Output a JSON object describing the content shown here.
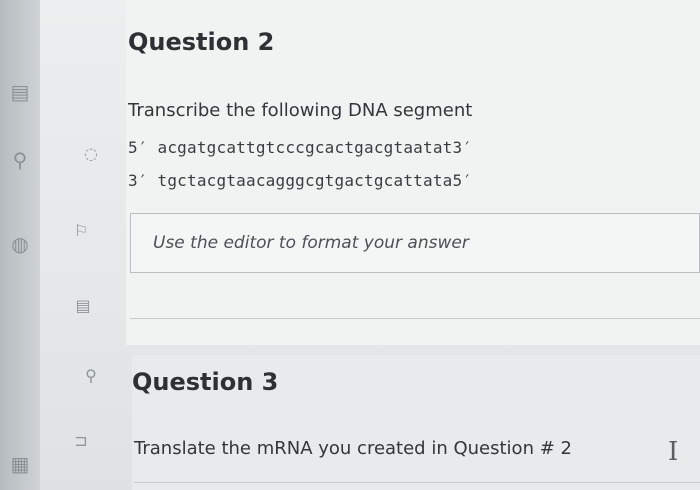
{
  "question2": {
    "title": "Question 2",
    "prompt": "Transcribe the following DNA segment",
    "strand_top": "5′ acgatgcattgtcccgcactgacgtaatat3′",
    "strand_bottom": "3′ tgctacgtaacagggcgtgactgcattata5′",
    "editor_placeholder": "Use the editor to format your answer"
  },
  "question3": {
    "title": "Question 3",
    "prompt": "Translate the mRNA you created in Question # 2"
  },
  "icons": {
    "rail": [
      "exam-icon",
      "search-icon",
      "globe-icon",
      "calculator-icon"
    ],
    "tools": [
      "flag-icon",
      "notepad-icon",
      "pin-icon",
      "bookmark-icon"
    ]
  }
}
